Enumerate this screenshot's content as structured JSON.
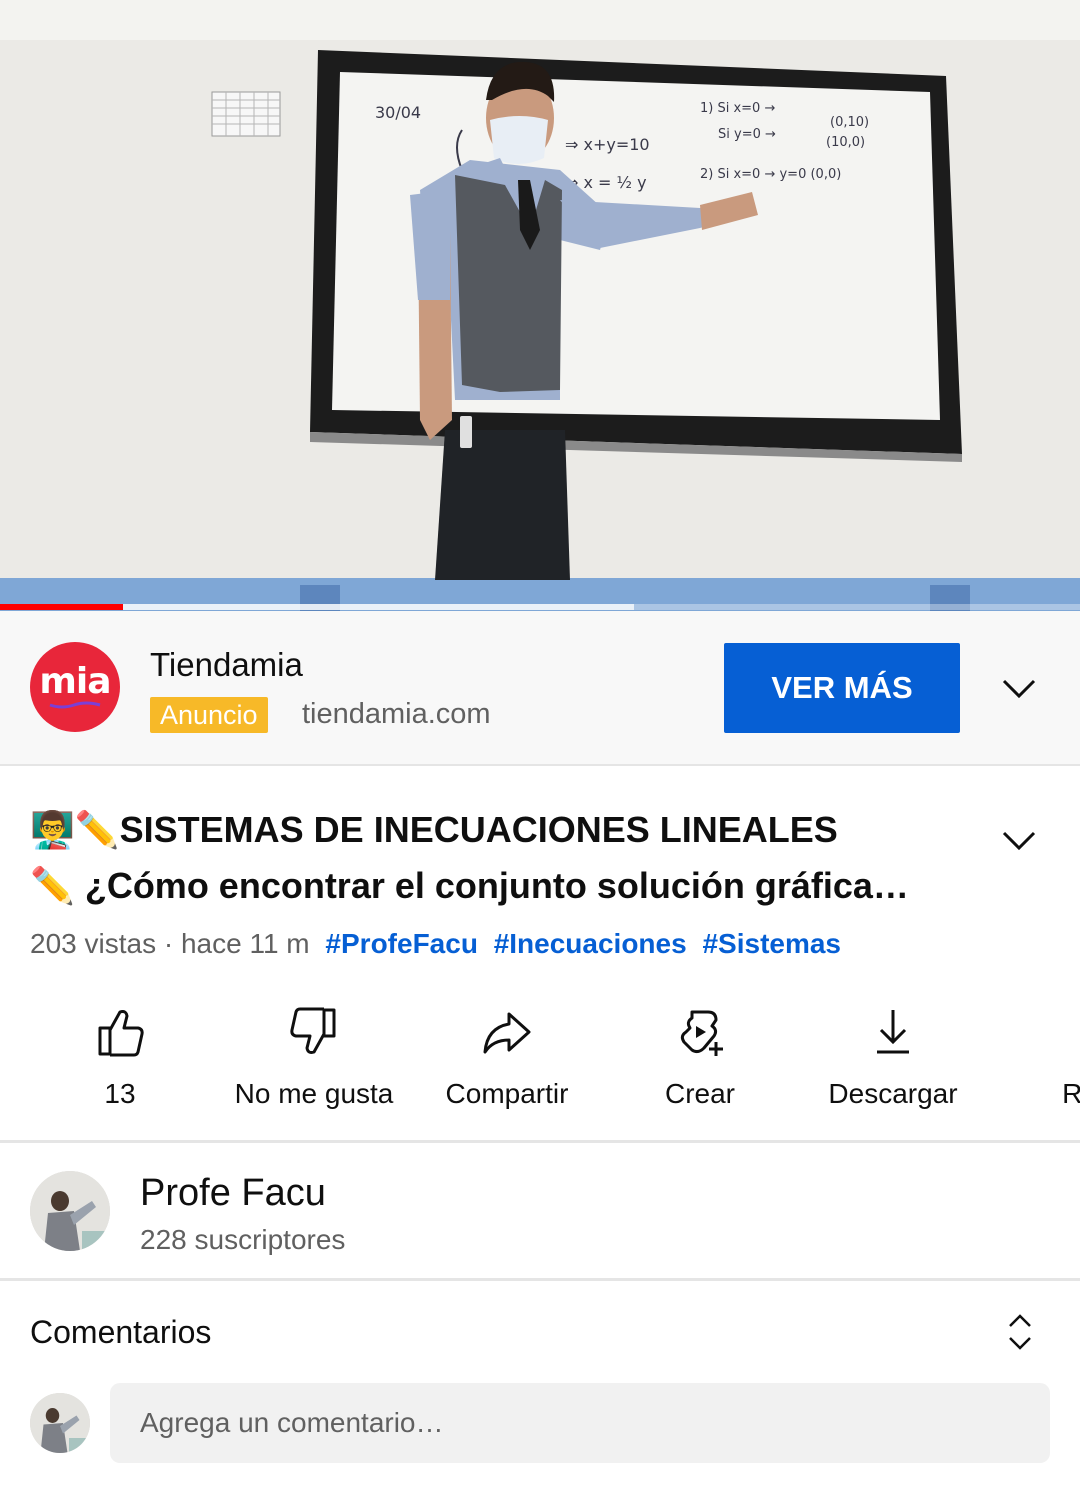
{
  "player": {
    "progress_played": 0.114,
    "progress_buffered": 0.587,
    "whiteboard_date": "30/04"
  },
  "ad": {
    "logo_text": "mia",
    "advertiser": "Tiendamia",
    "badge": "Anuncio",
    "url": "tiendamia.com",
    "cta_label": "VER MÁS",
    "colors": {
      "cta": "#065fd4",
      "badge": "#f7b928",
      "logo": "#e8263a"
    }
  },
  "video": {
    "title_line1": "👨‍🏫✏️SISTEMAS DE INECUACIONES LINEALES",
    "title_line2": "✏️ ¿Cómo encontrar el conjunto solución gráfica…",
    "views": "203 vistas",
    "time": "· hace 11 m",
    "hashtags": [
      "#ProfeFacu",
      "#Inecuaciones",
      "#Sistemas"
    ]
  },
  "actions": [
    {
      "icon": "thumbs-up-icon",
      "label": "13"
    },
    {
      "icon": "thumbs-down-icon",
      "label": "No me gusta"
    },
    {
      "icon": "share-icon",
      "label": "Compartir"
    },
    {
      "icon": "create-icon",
      "label": "Crear"
    },
    {
      "icon": "download-icon",
      "label": "Descargar"
    },
    {
      "icon": "remix-icon",
      "label": "Rec"
    }
  ],
  "channel": {
    "name": "Profe Facu",
    "subscribers": "228 suscriptores"
  },
  "comments": {
    "title": "Comentarios",
    "placeholder": "Agrega un comentario…"
  }
}
